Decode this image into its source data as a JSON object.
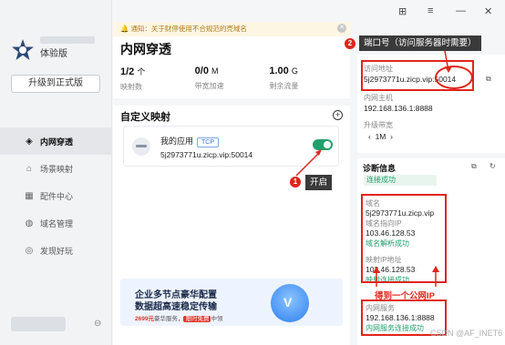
{
  "sidebar": {
    "version": "体验版",
    "upgrade_label": "升级到正式版",
    "items": [
      {
        "label": "内网穿透",
        "icon": "home-icon"
      },
      {
        "label": "场景映射",
        "icon": "scene-icon"
      },
      {
        "label": "配件中心",
        "icon": "grid-icon"
      },
      {
        "label": "域名管理",
        "icon": "globe-icon"
      },
      {
        "label": "发现好玩",
        "icon": "compass-icon"
      }
    ]
  },
  "notice": {
    "text": "通知：关于财停使用不合规范的壳域名"
  },
  "main": {
    "title": "内网穿透",
    "stats": [
      {
        "value": "1/2",
        "unit": "个",
        "label": "映射数"
      },
      {
        "value": "0/0",
        "unit": "M",
        "label": "带宽加速"
      },
      {
        "value": "1.00",
        "unit": "G",
        "label": "剩余流量"
      }
    ],
    "section_title": "自定义映射",
    "mapping": {
      "name": "我的应用",
      "protocol": "TCP",
      "address": "5j2973771u.zicp.vip:50014",
      "enabled": true
    },
    "ad": {
      "line1": "企业多节点豪华配置",
      "line2": "数据超高速稳定传输",
      "price": "2699元",
      "mid": "豪华服务，",
      "tag": "限时免费",
      "tail": "中领"
    }
  },
  "detail": {
    "access_label": "访问地址",
    "access_value": "5j2973771u.zicp.vip:50014",
    "host_label": "内网主机",
    "host_value": "192.168.136.1:8888",
    "bw_label": "升级带宽",
    "bw_value": "1M",
    "diag_title": "诊断信息",
    "diag_status": "连接成功",
    "domain_label": "域名",
    "domain_value": "5j2973771u.zicp.vip",
    "domain_ip_label": "域名指向IP",
    "domain_ip_value": "103.46.128.53",
    "domain_ip_status": "域名解析成功",
    "map_ip_label": "映射IP地址",
    "map_ip_value": "103.46.128.53",
    "map_ip_status": "映射连接成功",
    "lan_label": "内网服务",
    "lan_value": "192.168.136.1:8888",
    "lan_status": "内网服务连接成功"
  },
  "annotations": {
    "n1": "1",
    "n2": "2",
    "port_callout": "端口号（访问服务器时需要）",
    "open_callout": "开启",
    "public_ip": "得到一个公网IP",
    "watermark": "CSDN @AF_INET6"
  }
}
